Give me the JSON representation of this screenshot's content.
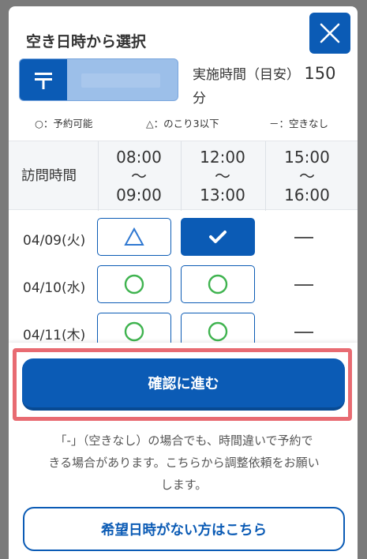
{
  "modal": {
    "title": "空き日時から選択",
    "close_icon": "close-icon"
  },
  "service": {
    "icon": "postal-mark-icon",
    "duration_label": "実施時間（目安）",
    "duration_value": "150",
    "duration_unit": "分"
  },
  "legend": {
    "available": "○：予約可能",
    "few_left": "△：のこり3以下",
    "none": "－：空きなし"
  },
  "schedule": {
    "header_label": "訪問時間",
    "slots": [
      {
        "start": "08:00",
        "sep": "〜",
        "end": "09:00"
      },
      {
        "start": "12:00",
        "sep": "〜",
        "end": "13:00"
      },
      {
        "start": "15:00",
        "sep": "〜",
        "end": "16:00"
      }
    ],
    "rows": [
      {
        "date": "04/09(火)",
        "cells": [
          "few",
          "selected",
          "none"
        ]
      },
      {
        "date": "04/10(水)",
        "cells": [
          "available",
          "available",
          "none"
        ]
      },
      {
        "date": "04/11(木)",
        "cells": [
          "available",
          "available",
          "none"
        ]
      }
    ]
  },
  "footer": {
    "confirm_label": "確認に進む",
    "notice_line1": "「-」（空きなし）の場合でも、時間違いで予約で",
    "notice_line2": "きる場合があります。こちらから調整依頼をお願い",
    "notice_line3": "します。",
    "alt_label": "希望日時がない方はこちら"
  },
  "colors": {
    "primary": "#0b5bb5",
    "available_symbol": "#3fb34f",
    "few_symbol": "#2f78d1",
    "highlight": "#e86b72"
  }
}
